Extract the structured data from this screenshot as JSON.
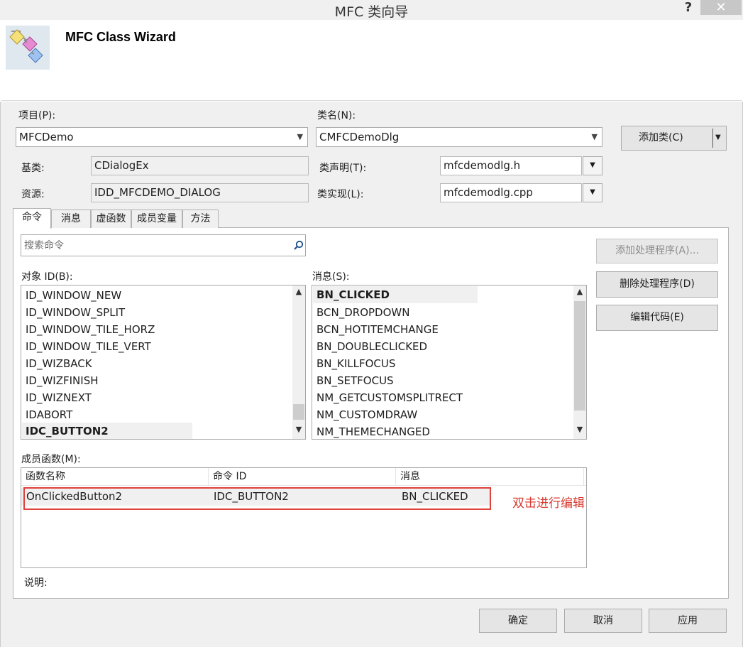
{
  "window": {
    "title": "MFC 类向导",
    "help_glyph": "?",
    "close_glyph": "✕"
  },
  "header": {
    "title": "MFC Class Wizard",
    "icon": "class-wizard-icon"
  },
  "project": {
    "label": "项目(P):",
    "value": "MFCDemo"
  },
  "class_name": {
    "label": "类名(N):",
    "value": "CMFCDemoDlg"
  },
  "add_class": {
    "label": "添加类(C)"
  },
  "base_class": {
    "label": "基类:",
    "value": "CDialogEx"
  },
  "resource": {
    "label": "资源:",
    "value": "IDD_MFCDEMO_DIALOG"
  },
  "class_decl": {
    "label": "类声明(T):",
    "value": "mfcdemodlg.h"
  },
  "class_impl": {
    "label": "类实现(L):",
    "value": "mfcdemodlg.cpp"
  },
  "tabs": [
    "命令",
    "消息",
    "虚函数",
    "成员变量",
    "方法"
  ],
  "search": {
    "placeholder": "搜索命令"
  },
  "object_ids": {
    "label": "对象 ID(B):",
    "items": [
      "ID_WINDOW_NEW",
      "ID_WINDOW_SPLIT",
      "ID_WINDOW_TILE_HORZ",
      "ID_WINDOW_TILE_VERT",
      "ID_WIZBACK",
      "ID_WIZFINISH",
      "ID_WIZNEXT",
      "IDABORT",
      "IDC_BUTTON2"
    ],
    "selected": "IDC_BUTTON2"
  },
  "messages": {
    "label": "消息(S):",
    "items": [
      "BN_CLICKED",
      "BCN_DROPDOWN",
      "BCN_HOTITEMCHANGE",
      "BN_DOUBLECLICKED",
      "BN_KILLFOCUS",
      "BN_SETFOCUS",
      "NM_GETCUSTOMSPLITRECT",
      "NM_CUSTOMDRAW",
      "NM_THEMECHANGED"
    ],
    "selected": "BN_CLICKED"
  },
  "handler_buttons": {
    "add": "添加处理程序(A)...",
    "delete": "删除处理程序(D)",
    "edit": "编辑代码(E)"
  },
  "member_functions": {
    "label": "成员函数(M):",
    "columns": [
      "函数名称",
      "命令 ID",
      "消息"
    ],
    "rows": [
      [
        "OnClickedButton2",
        "IDC_BUTTON2",
        "BN_CLICKED"
      ]
    ]
  },
  "annotation": "双击进行编辑",
  "description": {
    "label": "说明:"
  },
  "footer": {
    "ok": "确定",
    "cancel": "取消",
    "apply": "应用"
  },
  "colors": {
    "annotation": "#d83a30",
    "panel": "#f0f0f0"
  }
}
